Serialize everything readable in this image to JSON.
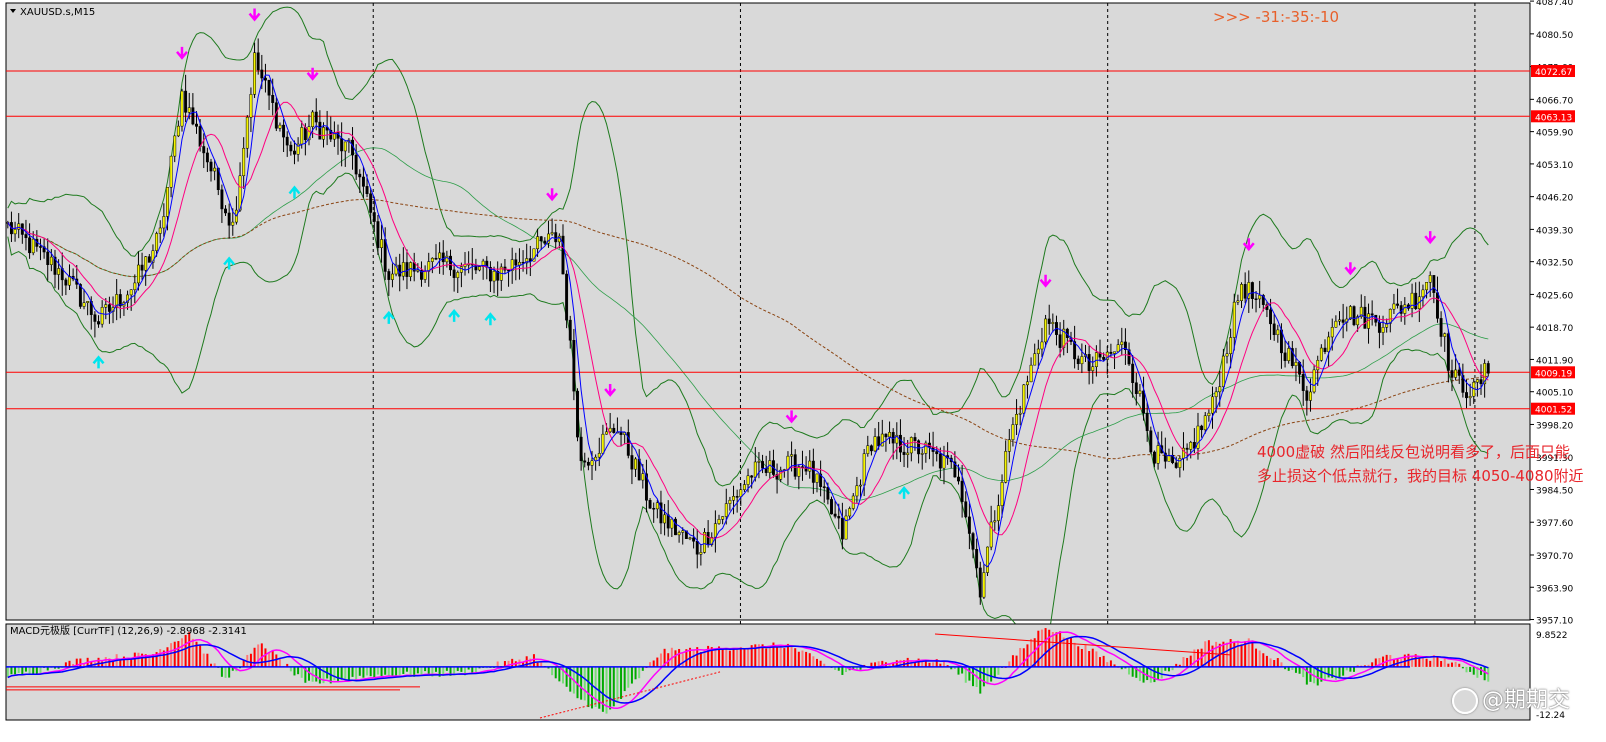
{
  "chart_data": [
    {
      "type": "candlestick",
      "title": "XAUUSD.s,M15",
      "top_right_text": ">>> -31:-35:-10",
      "ylim": [
        3957,
        4087
      ],
      "y_tick_labels": [
        "4087.40",
        "4080.50",
        "4073.60",
        "4066.70",
        "4059.90",
        "4053.10",
        "4046.20",
        "4039.30",
        "4032.50",
        "4025.60",
        "4018.70",
        "4011.90",
        "4005.10",
        "3998.20",
        "3991.30",
        "3984.50",
        "3977.60",
        "3970.70",
        "3963.90",
        "3957.10"
      ],
      "horizontal_levels": [
        {
          "label": "4072.67",
          "value": 4072.67
        },
        {
          "label": "4063.13",
          "value": 4063.13
        },
        {
          "label": "4009.19",
          "value": 4009.19
        },
        {
          "label": "4001.52",
          "value": 4001.52
        }
      ],
      "price_path": [
        {
          "bar": 0,
          "price": 4040
        },
        {
          "bar": 15,
          "price": 4030
        },
        {
          "bar": 25,
          "price": 4020
        },
        {
          "bar": 35,
          "price": 4028
        },
        {
          "bar": 42,
          "price": 4038
        },
        {
          "bar": 48,
          "price": 4068
        },
        {
          "bar": 56,
          "price": 4052
        },
        {
          "bar": 62,
          "price": 4040
        },
        {
          "bar": 68,
          "price": 4075
        },
        {
          "bar": 78,
          "price": 4055
        },
        {
          "bar": 84,
          "price": 4062
        },
        {
          "bar": 95,
          "price": 4055
        },
        {
          "bar": 105,
          "price": 4030
        },
        {
          "bar": 120,
          "price": 4032
        },
        {
          "bar": 135,
          "price": 4030
        },
        {
          "bar": 145,
          "price": 4035
        },
        {
          "bar": 152,
          "price": 4038
        },
        {
          "bar": 158,
          "price": 3990
        },
        {
          "bar": 168,
          "price": 3998
        },
        {
          "bar": 178,
          "price": 3980
        },
        {
          "bar": 190,
          "price": 3972
        },
        {
          "bar": 205,
          "price": 3988
        },
        {
          "bar": 220,
          "price": 3990
        },
        {
          "bar": 230,
          "price": 3975
        },
        {
          "bar": 238,
          "price": 3995
        },
        {
          "bar": 252,
          "price": 3993
        },
        {
          "bar": 262,
          "price": 3988
        },
        {
          "bar": 268,
          "price": 3964
        },
        {
          "bar": 276,
          "price": 3995
        },
        {
          "bar": 286,
          "price": 4020
        },
        {
          "bar": 298,
          "price": 4010
        },
        {
          "bar": 308,
          "price": 4015
        },
        {
          "bar": 316,
          "price": 3992
        },
        {
          "bar": 322,
          "price": 3988
        },
        {
          "bar": 332,
          "price": 4002
        },
        {
          "bar": 340,
          "price": 4028
        },
        {
          "bar": 348,
          "price": 4020
        },
        {
          "bar": 358,
          "price": 4005
        },
        {
          "bar": 366,
          "price": 4022
        },
        {
          "bar": 378,
          "price": 4020
        },
        {
          "bar": 388,
          "price": 4025
        },
        {
          "bar": 392,
          "price": 4030
        },
        {
          "bar": 398,
          "price": 4008
        },
        {
          "bar": 404,
          "price": 4005
        },
        {
          "bar": 408,
          "price": 4010
        }
      ],
      "x_time_separators_count": 4
    },
    {
      "type": "bar",
      "title": "MACD元极版 [CurrTF] (12,26,9) -2.8968 -2.3141",
      "ylim": [
        -12.2,
        9.8522
      ],
      "y_tick_labels": [
        "9.8522",
        "-12.24"
      ],
      "bar_levels": [
        {
          "bar": 0,
          "value": -2.5
        },
        {
          "bar": 20,
          "value": 1.5
        },
        {
          "bar": 40,
          "value": 3.0
        },
        {
          "bar": 50,
          "value": 8.0
        },
        {
          "bar": 60,
          "value": -3.0
        },
        {
          "bar": 70,
          "value": 5.5
        },
        {
          "bar": 82,
          "value": -4.0
        },
        {
          "bar": 100,
          "value": -2.0
        },
        {
          "bar": 125,
          "value": -1.5
        },
        {
          "bar": 145,
          "value": 2.5
        },
        {
          "bar": 155,
          "value": -6.0
        },
        {
          "bar": 165,
          "value": -11.0
        },
        {
          "bar": 180,
          "value": 3.5
        },
        {
          "bar": 200,
          "value": 4.5
        },
        {
          "bar": 215,
          "value": 5.0
        },
        {
          "bar": 230,
          "value": -1.5
        },
        {
          "bar": 245,
          "value": 2.0
        },
        {
          "bar": 258,
          "value": 1.0
        },
        {
          "bar": 268,
          "value": -5.5
        },
        {
          "bar": 286,
          "value": 9.5
        },
        {
          "bar": 300,
          "value": 3.0
        },
        {
          "bar": 315,
          "value": -4.0
        },
        {
          "bar": 330,
          "value": 5.5
        },
        {
          "bar": 342,
          "value": 6.0
        },
        {
          "bar": 360,
          "value": -4.5
        },
        {
          "bar": 380,
          "value": 2.5
        },
        {
          "bar": 395,
          "value": 2.0
        },
        {
          "bar": 408,
          "value": -3.0
        }
      ]
    }
  ],
  "annotation": {
    "line1": "4000虚破 然后阳线反包说明看多了，后面只能",
    "line2": "多止损这个低点就行，我的目标 4050-4080附近"
  },
  "watermark": "@期期交",
  "colors": {
    "bg": "#d9d9d9",
    "grid": "#ffffff",
    "candle_up": "#f5f500",
    "candle_down": "#000000",
    "level_line": "#ff0000",
    "bollinger": "#1e7a1e",
    "ma_fast": "#0000ff",
    "ma_mid": "#ff0080",
    "ma_slow": "#8b4513",
    "arrow_up": "#00e5ee",
    "arrow_down": "#ff00ff",
    "macd_pos": "#ff0000",
    "macd_neg": "#00aa00",
    "macd_zero": "#0000ff",
    "label_text": "#e8252b"
  }
}
